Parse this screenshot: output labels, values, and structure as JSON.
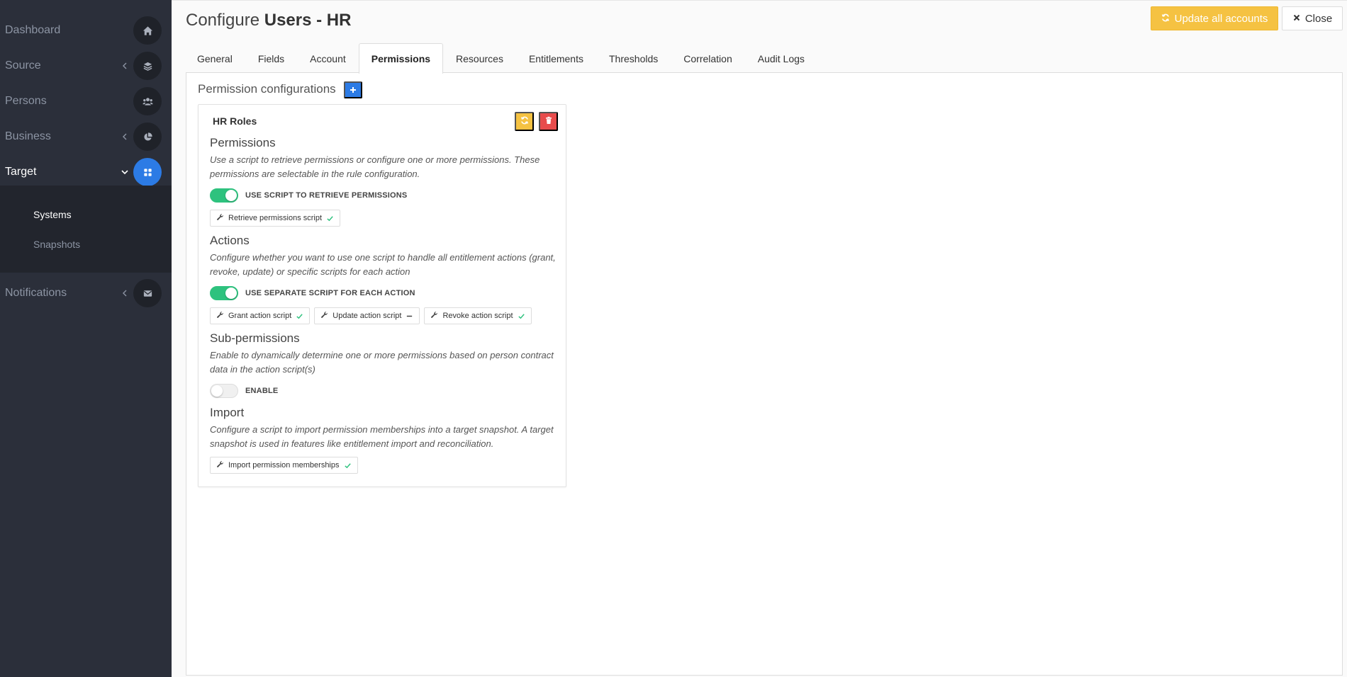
{
  "sidebar": {
    "items": [
      {
        "label": "Dashboard",
        "icon": "home-icon"
      },
      {
        "label": "Source",
        "icon": "layers-icon"
      },
      {
        "label": "Persons",
        "icon": "users-icon"
      },
      {
        "label": "Business",
        "icon": "pie-chart-icon"
      },
      {
        "label": "Target",
        "icon": "grid-icon"
      },
      {
        "label": "Notifications",
        "icon": "envelope-icon"
      }
    ],
    "submenu": [
      "Systems",
      "Snapshots"
    ]
  },
  "header": {
    "title_prefix": "Configure",
    "title_strong": "Users - HR",
    "update_label": "Update all accounts",
    "close_label": "Close"
  },
  "tabs": [
    "General",
    "Fields",
    "Account",
    "Permissions",
    "Resources",
    "Entitlements",
    "Thresholds",
    "Correlation",
    "Audit Logs"
  ],
  "active_tab": "Permissions",
  "section": {
    "title": "Permission configurations"
  },
  "card": {
    "title": "HR Roles",
    "permissions": {
      "title": "Permissions",
      "desc": "Use a script to retrieve permissions or configure one or more permissions. These permissions are selectable in the rule configuration.",
      "toggle_label": "USE SCRIPT TO RETRIEVE PERMISSIONS",
      "toggle_on": true,
      "chips": [
        {
          "label": "Retrieve permissions script",
          "status": "check"
        }
      ]
    },
    "actions": {
      "title": "Actions",
      "desc": "Configure whether you want to use one script to handle all entitlement actions (grant, revoke, update) or specific scripts for each action",
      "toggle_label": "USE SEPARATE SCRIPT FOR EACH ACTION",
      "toggle_on": true,
      "chips": [
        {
          "label": "Grant action script",
          "status": "check"
        },
        {
          "label": "Update action script",
          "status": "dash"
        },
        {
          "label": "Revoke action script",
          "status": "check"
        }
      ]
    },
    "subpermissions": {
      "title": "Sub-permissions",
      "desc": "Enable to dynamically determine one or more permissions based on person contract data in the action script(s)",
      "toggle_label": "ENABLE",
      "toggle_on": false
    },
    "import": {
      "title": "Import",
      "desc": "Configure a script to import permission memberships into a target snapshot. A target snapshot is used in features like entitlement import and reconciliation.",
      "chips": [
        {
          "label": "Import permission memberships",
          "status": "check"
        }
      ]
    }
  },
  "colors": {
    "sidebar_bg": "#2b2f3a",
    "accent_blue": "#2c7be5",
    "warning_yellow": "#f5c242",
    "danger_red": "#e84c4c",
    "success_green": "#2ec27e"
  }
}
